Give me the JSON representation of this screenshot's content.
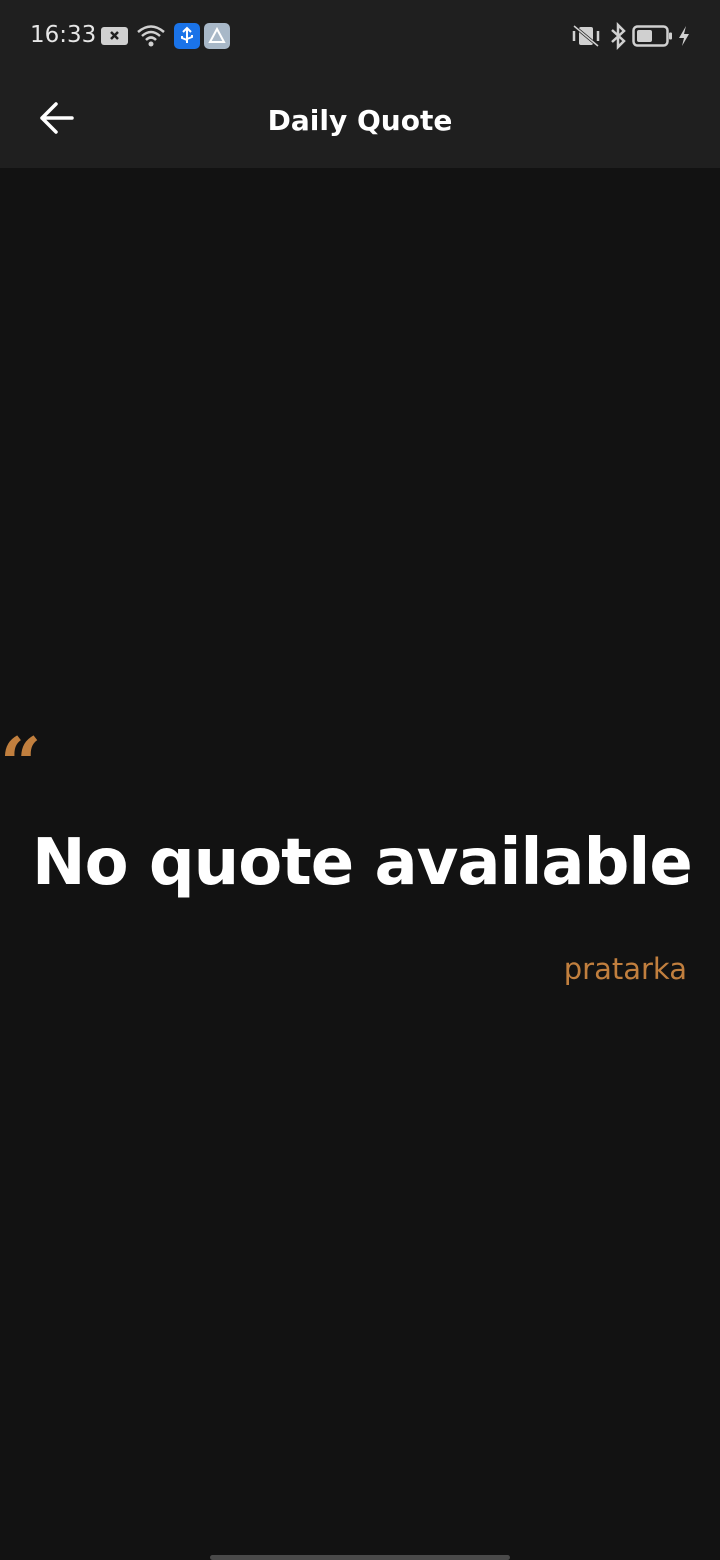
{
  "status_bar": {
    "time": "16:33",
    "icons": [
      "notification-icon",
      "wifi-icon",
      "usb-debug-icon",
      "app-icon",
      "vibrate-icon",
      "bluetooth-icon",
      "battery-icon",
      "charging-icon"
    ]
  },
  "app_bar": {
    "title": "Daily Quote",
    "back_icon": "arrow-left-icon"
  },
  "quote": {
    "mark": "“",
    "text": "No quote available",
    "author": "pratarka"
  },
  "colors": {
    "background": "#121212",
    "bar": "#1f1f1f",
    "accent": "#c17f3e",
    "text": "#ffffff"
  }
}
